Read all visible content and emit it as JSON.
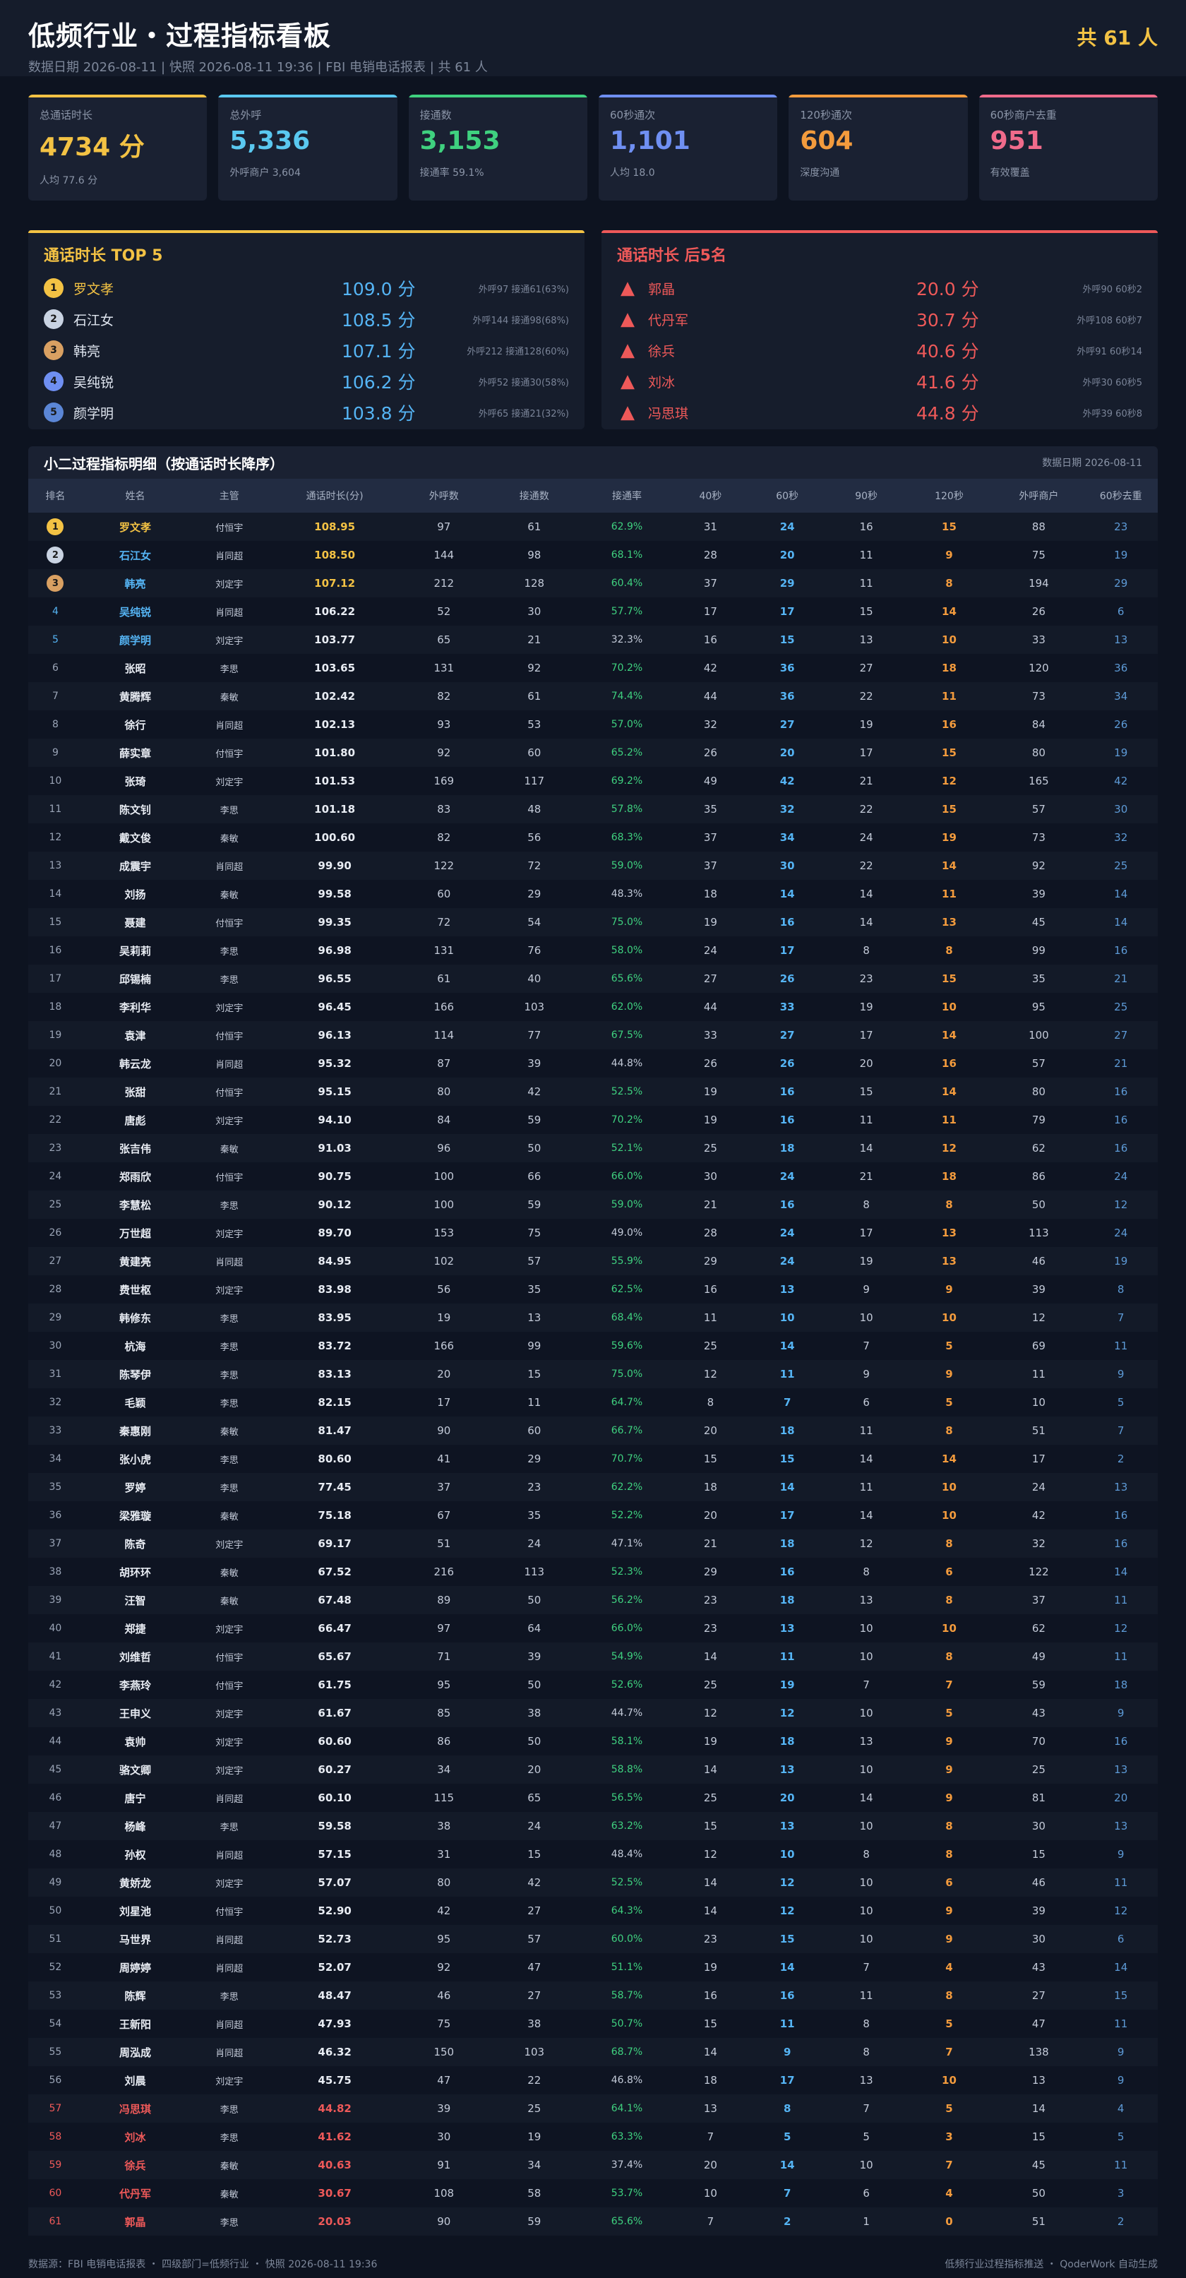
{
  "header": {
    "title": "低频行业・过程指标看板",
    "subtitle": "数据日期 2026-08-11 | 快照 2026-08-11 19:36 | FBI 电销电话报表 | 共 61 人",
    "total": "共 61 人"
  },
  "cards": [
    {
      "label": "总通话时长",
      "value": "4734 分",
      "sub": "人均 77.6 分",
      "color": "#f3c244"
    },
    {
      "label": "总外呼",
      "value": "5,336",
      "sub": "外呼商户 3,604",
      "color": "#5ac8f0"
    },
    {
      "label": "接通数",
      "value": "3,153",
      "sub": "接通率 59.1%",
      "color": "#3fd17f"
    },
    {
      "label": "60秒通次",
      "value": "1,101",
      "sub": "人均 18.0",
      "color": "#6f8ff2"
    },
    {
      "label": "120秒通次",
      "value": "604",
      "sub": "深度沟通",
      "color": "#f39b3d"
    },
    {
      "label": "60秒商户去重",
      "value": "951",
      "sub": "有效覆盖",
      "color": "#f06b8b"
    }
  ],
  "top5": {
    "title": "通话时长 TOP 5",
    "color": "#f3c244",
    "rows": [
      {
        "rank": "1",
        "name": "罗文孝",
        "value": "109.0 分",
        "meta": "外呼97 接通61(63%)",
        "badge": "#f3c244",
        "name_color": "#f3c244"
      },
      {
        "rank": "2",
        "name": "石江女",
        "value": "108.5 分",
        "meta": "外呼144 接通98(68%)",
        "badge": "#c9d3e2",
        "name_color": "#dfe5ef"
      },
      {
        "rank": "3",
        "name": "韩亮",
        "value": "107.1 分",
        "meta": "外呼212 接通128(60%)",
        "badge": "#d9a062",
        "name_color": "#dfe5ef"
      },
      {
        "rank": "4",
        "name": "吴纯锐",
        "value": "106.2 分",
        "meta": "外呼52 接通30(58%)",
        "badge": "#6f8ff2",
        "name_color": "#dfe5ef"
      },
      {
        "rank": "5",
        "name": "颜学明",
        "value": "103.8 分",
        "meta": "外呼65 接通21(32%)",
        "badge": "#5b86d6",
        "name_color": "#dfe5ef"
      }
    ]
  },
  "bottom5": {
    "title": "通话时长 后5名",
    "color": "#ee5959",
    "warn_glyph": "▲",
    "rows": [
      {
        "name": "郭晶",
        "value": "20.0 分",
        "meta": "外呼90 60秒2"
      },
      {
        "name": "代丹军",
        "value": "30.7 分",
        "meta": "外呼108 60秒7"
      },
      {
        "name": "徐兵",
        "value": "40.6 分",
        "meta": "外呼91 60秒14"
      },
      {
        "name": "刘冰",
        "value": "41.6 分",
        "meta": "外呼30 60秒5"
      },
      {
        "name": "冯思琪",
        "value": "44.8 分",
        "meta": "外呼39 60秒8"
      }
    ]
  },
  "detail": {
    "title": "小二过程指标明细（按通话时长降序）",
    "date": "数据日期 2026-08-11",
    "columns": [
      "排名",
      "姓名",
      "主管",
      "通话时长(分)",
      "外呼数",
      "接通数",
      "接通率",
      "40秒",
      "60秒",
      "90秒",
      "120秒",
      "外呼商户",
      "60秒去重"
    ],
    "rows": [
      [
        "1",
        "罗文孝",
        "付恒宇",
        "108.95",
        "97",
        "61",
        "62.9%",
        "31",
        "24",
        "16",
        "15",
        "88",
        "23"
      ],
      [
        "2",
        "石江女",
        "肖同超",
        "108.50",
        "144",
        "98",
        "68.1%",
        "28",
        "20",
        "11",
        "9",
        "75",
        "19"
      ],
      [
        "3",
        "韩亮",
        "刘定宇",
        "107.12",
        "212",
        "128",
        "60.4%",
        "37",
        "29",
        "11",
        "8",
        "194",
        "29"
      ],
      [
        "4",
        "吴纯锐",
        "肖同超",
        "106.22",
        "52",
        "30",
        "57.7%",
        "17",
        "17",
        "15",
        "14",
        "26",
        "6"
      ],
      [
        "5",
        "颜学明",
        "刘定宇",
        "103.77",
        "65",
        "21",
        "32.3%",
        "16",
        "15",
        "13",
        "10",
        "33",
        "13"
      ],
      [
        "6",
        "张昭",
        "李思",
        "103.65",
        "131",
        "92",
        "70.2%",
        "42",
        "36",
        "27",
        "18",
        "120",
        "36"
      ],
      [
        "7",
        "黄腾辉",
        "秦敏",
        "102.42",
        "82",
        "61",
        "74.4%",
        "44",
        "36",
        "22",
        "11",
        "73",
        "34"
      ],
      [
        "8",
        "徐行",
        "肖同超",
        "102.13",
        "93",
        "53",
        "57.0%",
        "32",
        "27",
        "19",
        "16",
        "84",
        "26"
      ],
      [
        "9",
        "薛实章",
        "付恒宇",
        "101.80",
        "92",
        "60",
        "65.2%",
        "26",
        "20",
        "17",
        "15",
        "80",
        "19"
      ],
      [
        "10",
        "张琦",
        "刘定宇",
        "101.53",
        "169",
        "117",
        "69.2%",
        "49",
        "42",
        "21",
        "12",
        "165",
        "42"
      ],
      [
        "11",
        "陈文钊",
        "李思",
        "101.18",
        "83",
        "48",
        "57.8%",
        "35",
        "32",
        "22",
        "15",
        "57",
        "30"
      ],
      [
        "12",
        "戴文俊",
        "秦敏",
        "100.60",
        "82",
        "56",
        "68.3%",
        "37",
        "34",
        "24",
        "19",
        "73",
        "32"
      ],
      [
        "13",
        "成震宇",
        "肖同超",
        "99.90",
        "122",
        "72",
        "59.0%",
        "37",
        "30",
        "22",
        "14",
        "92",
        "25"
      ],
      [
        "14",
        "刘扬",
        "秦敏",
        "99.58",
        "60",
        "29",
        "48.3%",
        "18",
        "14",
        "14",
        "11",
        "39",
        "14"
      ],
      [
        "15",
        "聂建",
        "付恒宇",
        "99.35",
        "72",
        "54",
        "75.0%",
        "19",
        "16",
        "14",
        "13",
        "45",
        "14"
      ],
      [
        "16",
        "吴莉莉",
        "李思",
        "96.98",
        "131",
        "76",
        "58.0%",
        "24",
        "17",
        "8",
        "8",
        "99",
        "16"
      ],
      [
        "17",
        "邱锡楠",
        "李思",
        "96.55",
        "61",
        "40",
        "65.6%",
        "27",
        "26",
        "23",
        "15",
        "35",
        "21"
      ],
      [
        "18",
        "李利华",
        "刘定宇",
        "96.45",
        "166",
        "103",
        "62.0%",
        "44",
        "33",
        "19",
        "10",
        "95",
        "25"
      ],
      [
        "19",
        "袁津",
        "付恒宇",
        "96.13",
        "114",
        "77",
        "67.5%",
        "33",
        "27",
        "17",
        "14",
        "100",
        "27"
      ],
      [
        "20",
        "韩云龙",
        "肖同超",
        "95.32",
        "87",
        "39",
        "44.8%",
        "26",
        "26",
        "20",
        "16",
        "57",
        "21"
      ],
      [
        "21",
        "张甜",
        "付恒宇",
        "95.15",
        "80",
        "42",
        "52.5%",
        "19",
        "16",
        "15",
        "14",
        "80",
        "16"
      ],
      [
        "22",
        "唐彪",
        "刘定宇",
        "94.10",
        "84",
        "59",
        "70.2%",
        "19",
        "16",
        "11",
        "11",
        "79",
        "16"
      ],
      [
        "23",
        "张吉伟",
        "秦敏",
        "91.03",
        "96",
        "50",
        "52.1%",
        "25",
        "18",
        "14",
        "12",
        "62",
        "16"
      ],
      [
        "24",
        "郑雨欣",
        "付恒宇",
        "90.75",
        "100",
        "66",
        "66.0%",
        "30",
        "24",
        "21",
        "18",
        "86",
        "24"
      ],
      [
        "25",
        "李慧松",
        "李思",
        "90.12",
        "100",
        "59",
        "59.0%",
        "21",
        "16",
        "8",
        "8",
        "50",
        "12"
      ],
      [
        "26",
        "万世超",
        "刘定宇",
        "89.70",
        "153",
        "75",
        "49.0%",
        "28",
        "24",
        "17",
        "13",
        "113",
        "24"
      ],
      [
        "27",
        "黄建亮",
        "肖同超",
        "84.95",
        "102",
        "57",
        "55.9%",
        "29",
        "24",
        "19",
        "13",
        "46",
        "19"
      ],
      [
        "28",
        "费世枢",
        "刘定宇",
        "83.98",
        "56",
        "35",
        "62.5%",
        "16",
        "13",
        "9",
        "9",
        "39",
        "8"
      ],
      [
        "29",
        "韩修东",
        "李思",
        "83.95",
        "19",
        "13",
        "68.4%",
        "11",
        "10",
        "10",
        "10",
        "12",
        "7"
      ],
      [
        "30",
        "杭海",
        "李思",
        "83.72",
        "166",
        "99",
        "59.6%",
        "25",
        "14",
        "7",
        "5",
        "69",
        "11"
      ],
      [
        "31",
        "陈琴伊",
        "李思",
        "83.13",
        "20",
        "15",
        "75.0%",
        "12",
        "11",
        "9",
        "9",
        "11",
        "9"
      ],
      [
        "32",
        "毛颖",
        "李思",
        "82.15",
        "17",
        "11",
        "64.7%",
        "8",
        "7",
        "6",
        "5",
        "10",
        "5"
      ],
      [
        "33",
        "秦惠刚",
        "秦敏",
        "81.47",
        "90",
        "60",
        "66.7%",
        "20",
        "18",
        "11",
        "8",
        "51",
        "7"
      ],
      [
        "34",
        "张小虎",
        "李思",
        "80.60",
        "41",
        "29",
        "70.7%",
        "15",
        "15",
        "14",
        "14",
        "17",
        "2"
      ],
      [
        "35",
        "罗婷",
        "李思",
        "77.45",
        "37",
        "23",
        "62.2%",
        "18",
        "14",
        "11",
        "10",
        "24",
        "13"
      ],
      [
        "36",
        "梁雅璇",
        "秦敏",
        "75.18",
        "67",
        "35",
        "52.2%",
        "20",
        "17",
        "14",
        "10",
        "42",
        "16"
      ],
      [
        "37",
        "陈奇",
        "刘定宇",
        "69.17",
        "51",
        "24",
        "47.1%",
        "21",
        "18",
        "12",
        "8",
        "32",
        "16"
      ],
      [
        "38",
        "胡环环",
        "秦敏",
        "67.52",
        "216",
        "113",
        "52.3%",
        "29",
        "16",
        "8",
        "6",
        "122",
        "14"
      ],
      [
        "39",
        "汪智",
        "秦敏",
        "67.48",
        "89",
        "50",
        "56.2%",
        "23",
        "18",
        "13",
        "8",
        "37",
        "11"
      ],
      [
        "40",
        "郑捷",
        "刘定宇",
        "66.47",
        "97",
        "64",
        "66.0%",
        "23",
        "13",
        "10",
        "10",
        "62",
        "12"
      ],
      [
        "41",
        "刘维哲",
        "付恒宇",
        "65.67",
        "71",
        "39",
        "54.9%",
        "14",
        "11",
        "10",
        "8",
        "49",
        "11"
      ],
      [
        "42",
        "李燕玲",
        "付恒宇",
        "61.75",
        "95",
        "50",
        "52.6%",
        "25",
        "19",
        "7",
        "7",
        "59",
        "18"
      ],
      [
        "43",
        "王申义",
        "刘定宇",
        "61.67",
        "85",
        "38",
        "44.7%",
        "12",
        "12",
        "10",
        "5",
        "43",
        "9"
      ],
      [
        "44",
        "袁帅",
        "刘定宇",
        "60.60",
        "86",
        "50",
        "58.1%",
        "19",
        "18",
        "13",
        "9",
        "70",
        "16"
      ],
      [
        "45",
        "骆文卿",
        "刘定宇",
        "60.27",
        "34",
        "20",
        "58.8%",
        "14",
        "13",
        "10",
        "9",
        "25",
        "13"
      ],
      [
        "46",
        "唐宁",
        "肖同超",
        "60.10",
        "115",
        "65",
        "56.5%",
        "25",
        "20",
        "14",
        "9",
        "81",
        "20"
      ],
      [
        "47",
        "杨峰",
        "李思",
        "59.58",
        "38",
        "24",
        "63.2%",
        "15",
        "13",
        "10",
        "8",
        "30",
        "13"
      ],
      [
        "48",
        "孙权",
        "肖同超",
        "57.15",
        "31",
        "15",
        "48.4%",
        "12",
        "10",
        "8",
        "8",
        "15",
        "9"
      ],
      [
        "49",
        "黄娇龙",
        "刘定宇",
        "57.07",
        "80",
        "42",
        "52.5%",
        "14",
        "12",
        "10",
        "6",
        "46",
        "11"
      ],
      [
        "50",
        "刘星池",
        "付恒宇",
        "52.90",
        "42",
        "27",
        "64.3%",
        "14",
        "12",
        "10",
        "9",
        "39",
        "12"
      ],
      [
        "51",
        "马世界",
        "肖同超",
        "52.73",
        "95",
        "57",
        "60.0%",
        "23",
        "15",
        "10",
        "9",
        "30",
        "6"
      ],
      [
        "52",
        "周婷婷",
        "肖同超",
        "52.07",
        "92",
        "47",
        "51.1%",
        "19",
        "14",
        "7",
        "4",
        "43",
        "14"
      ],
      [
        "53",
        "陈辉",
        "李思",
        "48.47",
        "46",
        "27",
        "58.7%",
        "16",
        "16",
        "11",
        "8",
        "27",
        "15"
      ],
      [
        "54",
        "王新阳",
        "肖同超",
        "47.93",
        "75",
        "38",
        "50.7%",
        "15",
        "11",
        "8",
        "5",
        "47",
        "11"
      ],
      [
        "55",
        "周泓成",
        "肖同超",
        "46.32",
        "150",
        "103",
        "68.7%",
        "14",
        "9",
        "8",
        "7",
        "138",
        "9"
      ],
      [
        "56",
        "刘晨",
        "刘定宇",
        "45.75",
        "47",
        "22",
        "46.8%",
        "18",
        "17",
        "13",
        "10",
        "13",
        "9"
      ],
      [
        "57",
        "冯思琪",
        "李思",
        "44.82",
        "39",
        "25",
        "64.1%",
        "13",
        "8",
        "7",
        "5",
        "14",
        "4"
      ],
      [
        "58",
        "刘冰",
        "李思",
        "41.62",
        "30",
        "19",
        "63.3%",
        "7",
        "5",
        "5",
        "3",
        "15",
        "5"
      ],
      [
        "59",
        "徐兵",
        "秦敏",
        "40.63",
        "91",
        "34",
        "37.4%",
        "20",
        "14",
        "10",
        "7",
        "45",
        "11"
      ],
      [
        "60",
        "代丹军",
        "秦敏",
        "30.67",
        "108",
        "58",
        "53.7%",
        "10",
        "7",
        "6",
        "4",
        "50",
        "3"
      ],
      [
        "61",
        "郭晶",
        "李思",
        "20.03",
        "90",
        "59",
        "65.6%",
        "7",
        "2",
        "1",
        "0",
        "51",
        "2"
      ]
    ]
  },
  "colors": {
    "gold": "#f3c244",
    "silver": "#c9d3e2",
    "bronze": "#d9a062",
    "blue_name": "#55b4f4",
    "red": "#ee5959",
    "green": "#3fd17f"
  },
  "footer": {
    "left": "数据源：FBI 电销电话报表 ・ 四级部门=低频行业 ・ 快照 2026-08-11 19:36",
    "right": "低频行业过程指标推送 ・ QoderWork 自动生成"
  }
}
